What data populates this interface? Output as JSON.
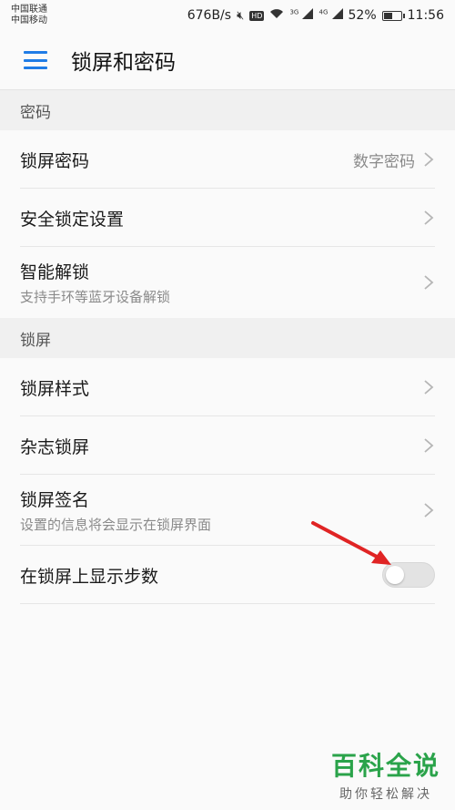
{
  "status_bar": {
    "carrier1": "中国联通",
    "carrier2": "中国移动",
    "speed": "676B/s",
    "hd": "HD",
    "net1": "3G",
    "net2": "4G",
    "battery": "52%",
    "battery_level": 0.52,
    "time": "11:56"
  },
  "app_bar": {
    "title": "锁屏和密码",
    "menu_icon": "menu-icon",
    "accent_color": "#1f7ce6"
  },
  "sections": {
    "password": {
      "header": "密码",
      "items": [
        {
          "title": "锁屏密码",
          "value": "数字密码"
        },
        {
          "title": "安全锁定设置"
        },
        {
          "title": "智能解锁",
          "subtitle": "支持手环等蓝牙设备解锁"
        }
      ]
    },
    "lockscreen": {
      "header": "锁屏",
      "items": [
        {
          "title": "锁屏样式"
        },
        {
          "title": "杂志锁屏"
        },
        {
          "title": "锁屏签名",
          "subtitle": "设置的信息将会显示在锁屏界面"
        },
        {
          "title": "在锁屏上显示步数",
          "toggle": false
        }
      ]
    }
  },
  "watermark": {
    "main": "百科全说",
    "sub": "助你轻松解决"
  }
}
